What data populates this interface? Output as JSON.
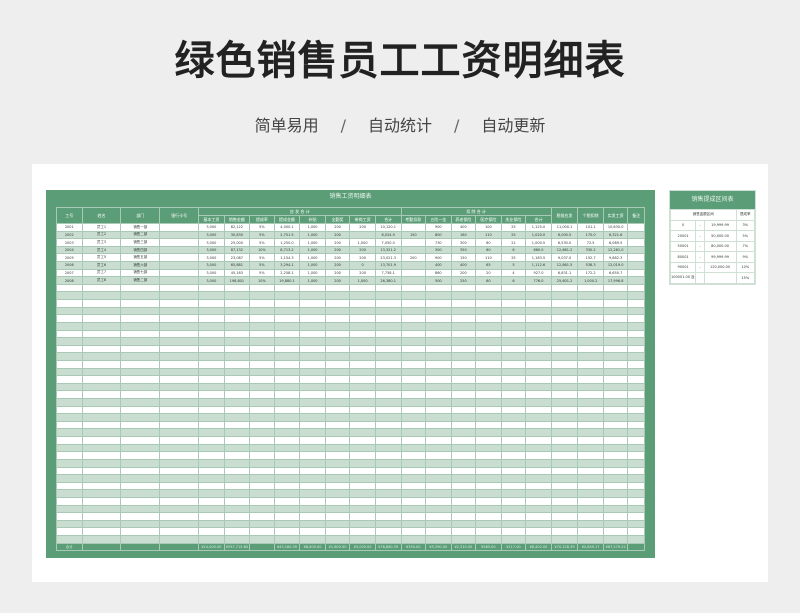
{
  "page": {
    "title": "绿色销售员工工资明细表",
    "features": [
      "简单易用",
      "自动统计",
      "自动更新"
    ],
    "separator": "/"
  },
  "main_sheet": {
    "title": "销售工资明细表",
    "group_headers": {
      "income": "应 发 合 计",
      "deduction": "扣 除 合 计"
    },
    "headers": [
      "工号",
      "姓名",
      "部门",
      "银行卡号",
      "基本工资",
      "销售金额",
      "提成率",
      "提成金额",
      "补贴",
      "全勤奖",
      "带岗工资",
      "合计",
      "考勤扣款",
      "五险一金",
      "养老保险",
      "医疗保险",
      "失业保险",
      "合计",
      "税前应发",
      "个税扣除",
      "实发工资",
      "备注"
    ],
    "rows": [
      [
        "2001",
        "员工1",
        "销售一部",
        "",
        "3,000",
        "82,122",
        "5%",
        "4,000.1",
        "1,000",
        "200",
        "200",
        "10,120.1",
        "",
        "900",
        "400",
        "100",
        "25",
        "1,125.0",
        "11,000.1",
        "101.1",
        "10,630.0",
        ""
      ],
      [
        "2002",
        "员工2",
        "销售二部",
        "",
        "3,000",
        "30,830",
        "5%",
        "2,751.5",
        "1,000",
        "200",
        "",
        "6,024.9",
        "150",
        "800",
        "160",
        "110",
        "25",
        "1,020.0",
        "6,000.5",
        "170.0",
        "6,321.6",
        ""
      ],
      [
        "2003",
        "员工3",
        "销售三部",
        "",
        "3,000",
        "25,000",
        "5%",
        "1,250.0",
        "1,000",
        "200",
        "1,000",
        "7,050.0",
        "",
        "730",
        "300",
        "60",
        "21",
        "1,000.5",
        "6,530.0",
        "72.5",
        "6,089.5",
        ""
      ],
      [
        "2004",
        "员工4",
        "销售四部",
        "",
        "3,000",
        "87,132",
        "10%",
        "8,713.2",
        "1,000",
        "200",
        "200",
        "13,321.2",
        "",
        "300",
        "350",
        "60",
        "6",
        "660.0",
        "12,661.2",
        "330.2",
        "12,261.0",
        ""
      ],
      [
        "2005",
        "员工5",
        "销售五部",
        "",
        "3,000",
        "23,087",
        "5%",
        "1,154.3",
        "1,000",
        "200",
        "200",
        "23,021.3",
        "200",
        "900",
        "150",
        "110",
        "25",
        "1,183.5",
        "9,037.0",
        "152.7",
        "9,882.3",
        ""
      ],
      [
        "2006",
        "员工6",
        "销售六部",
        "",
        "3,000",
        "65,881",
        "5%",
        "3,294.1",
        "1,000",
        "200",
        "0",
        "13,701.9",
        "",
        "400",
        "400",
        "65",
        "5",
        "1,112.6",
        "12,861.5",
        "538.3",
        "12,019.0",
        ""
      ],
      [
        "2007",
        "员工7",
        "销售七部",
        "",
        "3,000",
        "45,163",
        "5%",
        "2,258.1",
        "1,000",
        "200",
        "200",
        "7,758.1",
        "",
        "860",
        "200",
        "20",
        "4",
        "927.0",
        "6,831.1",
        "172.2",
        "6,650.7",
        ""
      ],
      [
        "2008",
        "员工8",
        "销售二部",
        "",
        "3,000",
        "198,801",
        "10%",
        "19,880.1",
        "1,000",
        "200",
        "1,000",
        "26,380.1",
        "",
        "500",
        "250",
        "60",
        "6",
        "776.0",
        "25,601.2",
        "1,000.2",
        "17,996.8",
        ""
      ]
    ],
    "total_row": [
      "合计",
      "",
      "",
      "",
      "¥24,000.00",
      "¥557,715.80",
      "",
      "¥43,180.39",
      "¥8,000.00",
      "¥1,600.00",
      "¥3,000.00",
      "¥78,880.39",
      "¥350.00",
      "¥5,390.00",
      "¥2,310.00",
      "¥585.00",
      "¥117.00",
      "¥8,402.00",
      "¥70,128.39",
      "¥2,849.17",
      "¥67,279.22",
      ""
    ]
  },
  "side_sheet": {
    "title": "销售提成区间表",
    "headers": [
      "销售金额区间",
      "提成率"
    ],
    "rows": [
      [
        "0",
        "-",
        "19,999.99",
        "3%"
      ],
      [
        "20001",
        "-",
        "50,000.00",
        "5%"
      ],
      [
        "50001",
        "-",
        "80,000.00",
        "7%"
      ],
      [
        "80001",
        "-",
        "99,999.99",
        "9%"
      ],
      [
        "90001",
        "-",
        "120,000.00",
        "10%"
      ],
      [
        "100001.00 及以上",
        "",
        "",
        "15%"
      ]
    ]
  },
  "colors": {
    "accent": "#5a9d76",
    "stripe": "#c9ddd0",
    "background": "#eeeeee"
  }
}
